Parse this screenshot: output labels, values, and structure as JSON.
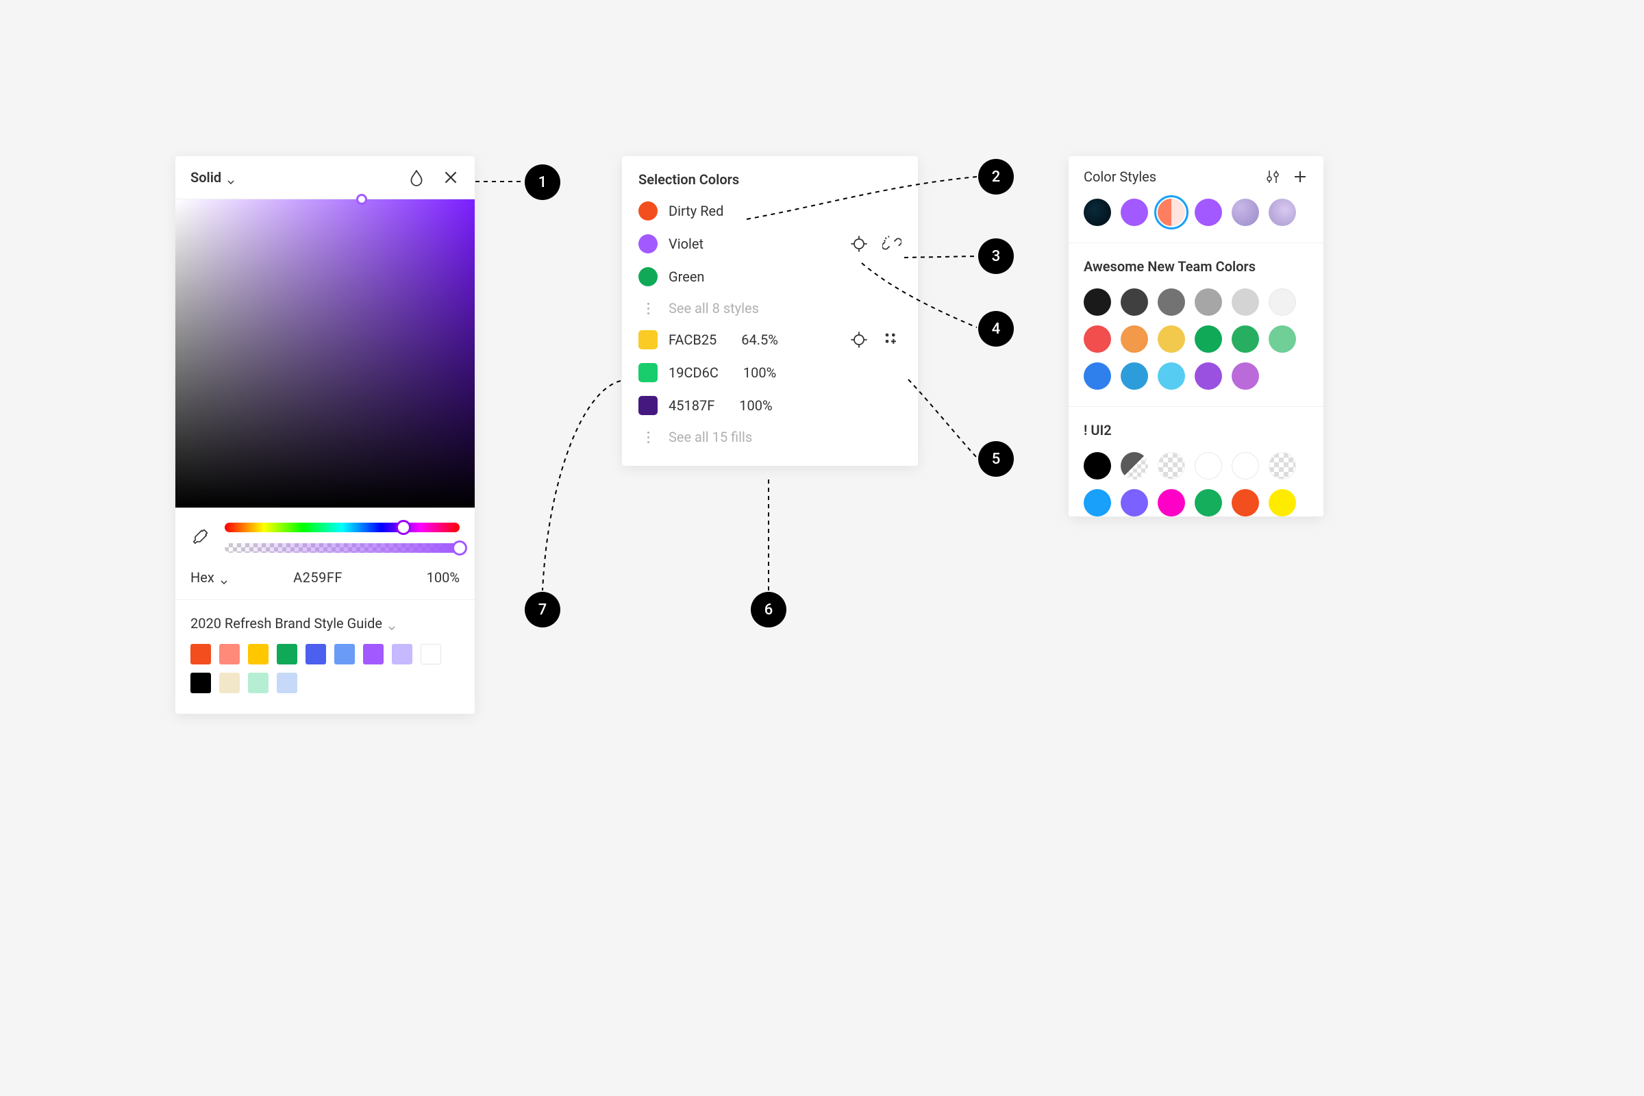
{
  "picker": {
    "mode_label": "Solid",
    "hex_mode_label": "Hex",
    "hex_value": "A259FF",
    "opacity": "100%",
    "library_title": "2020 Refresh Brand Style Guide",
    "swatches": [
      "#F24E1E",
      "#FF8A7A",
      "#FFC700",
      "#0FA958",
      "#4C5FEF",
      "#699BF7",
      "#A259FF",
      "#C7B9FF",
      "#FFFFFF",
      "#000000",
      "#F3E7C9",
      "#B6EED4",
      "#C7D9F9"
    ]
  },
  "selection": {
    "title": "Selection Colors",
    "styles": [
      {
        "name": "Dirty Red",
        "color": "#F24E1E"
      },
      {
        "name": "Violet",
        "color": "#A259FF"
      },
      {
        "name": "Green",
        "color": "#0FA958"
      }
    ],
    "see_all_styles": "See all 8 styles",
    "fills": [
      {
        "hex": "FACB25",
        "pct": "64.5%",
        "color": "#FACB25"
      },
      {
        "hex": "19CD6C",
        "pct": "100%",
        "color": "#19CD6C"
      },
      {
        "hex": "45187F",
        "pct": "100%",
        "color": "#45187F"
      }
    ],
    "see_all_fills": "See all 15 fills"
  },
  "color_styles": {
    "title": "Color Styles",
    "groups": [
      {
        "name": "Awesome New Team Colors",
        "colors": [
          "#1a1a1a",
          "#404040",
          "#737373",
          "#a6a6a6",
          "#d4d4d4",
          "#f2f2f2",
          "#f24e4e",
          "#f2994a",
          "#f2c94c",
          "#0fa958",
          "#27ae60",
          "#6fcf97",
          "#2f80ed",
          "#2d9cdb",
          "#56ccf2",
          "#9b51e0",
          "#bb6bd9"
        ]
      },
      {
        "name": "! UI2",
        "colors": [
          "#000000",
          "halfchecker",
          "checker",
          "#ffffff",
          "#ffffff",
          "checker",
          "#18a0fb",
          "#7b61ff",
          "#ff00c7",
          "#14ae5c",
          "#f24e1e",
          "#ffeb00"
        ]
      }
    ]
  },
  "callouts": [
    "1",
    "2",
    "3",
    "4",
    "5",
    "6",
    "7"
  ]
}
